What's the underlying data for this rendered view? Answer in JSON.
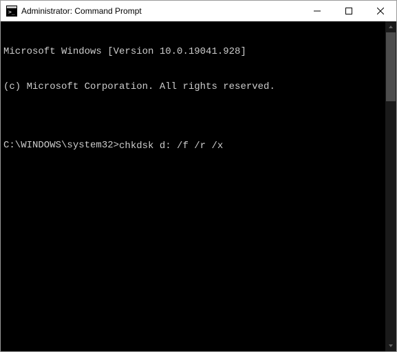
{
  "window": {
    "title": "Administrator: Command Prompt"
  },
  "terminal": {
    "lines": [
      "Microsoft Windows [Version 10.0.19041.928]",
      "(c) Microsoft Corporation. All rights reserved.",
      ""
    ],
    "prompt": "C:\\WINDOWS\\system32>",
    "command": "chkdsk d: /f /r /x"
  }
}
